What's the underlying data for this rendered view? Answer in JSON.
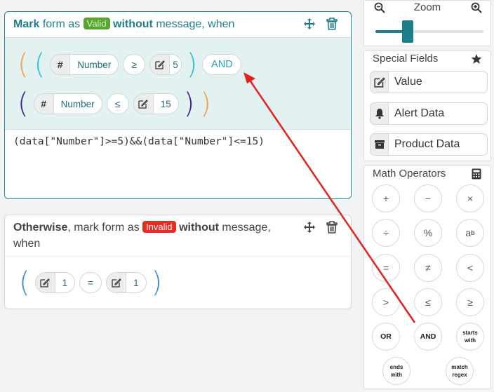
{
  "rule1": {
    "mark_word": "Mark",
    "form_as": "form as",
    "badge": "Valid",
    "without_word": "without",
    "tail": "message, when",
    "group1": {
      "field": "Number",
      "op": "≥",
      "value": "5",
      "logic": "AND"
    },
    "group2": {
      "field": "Number",
      "op": "≤",
      "value": "15"
    },
    "code": "(data[\"Number\"]>=5)&&(data[\"Number\"]<=15)"
  },
  "rule2": {
    "otherwise_word": "Otherwise",
    "mark_form_as": ", mark form as",
    "badge": "Invalid",
    "without_word": "without",
    "tail": "message,",
    "tail2": "when",
    "left_value": "1",
    "op": "=",
    "right_value": "1"
  },
  "zoom": {
    "title": "Zoom",
    "level": 0.3
  },
  "special_fields": {
    "title": "Special Fields",
    "items": [
      {
        "label": "Value",
        "icon": "edit-icon"
      },
      {
        "label": "Alert Data",
        "icon": "bell-icon"
      },
      {
        "label": "Product Data",
        "icon": "archive-icon"
      }
    ]
  },
  "math_operators": {
    "title": "Math Operators",
    "buttons": [
      "+",
      "−",
      "×",
      "÷",
      "%",
      "a",
      "=",
      "≠",
      "<",
      ">",
      "≤",
      "≥",
      "OR",
      "AND",
      "starts",
      "with",
      "ends",
      "with",
      "match",
      "regex"
    ],
    "power_sup": "b"
  },
  "colors": {
    "accent": "#1f8a96",
    "valid": "#5aa52f",
    "invalid": "#e62b23",
    "annotation_arrow": "#e8201c"
  }
}
